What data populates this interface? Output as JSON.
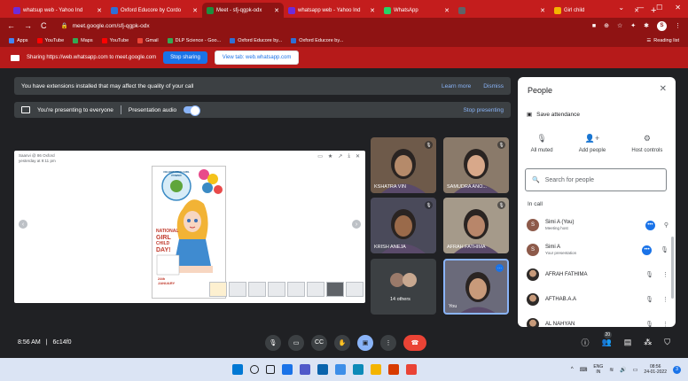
{
  "browser": {
    "tabs": [
      {
        "title": "whatsup web - Yahoo Ind",
        "color": "#6e2bd9",
        "active": false
      },
      {
        "title": "Oxford Educore by Cordo",
        "color": "#2f6fd6",
        "active": false
      },
      {
        "title": "Meet - sfj-qgpk-odx",
        "color": "#1e8e3e",
        "active": true
      },
      {
        "title": "whatsapp web - Yahoo Ind",
        "color": "#6e2bd9",
        "active": false
      },
      {
        "title": "WhatsApp",
        "color": "#25d366",
        "active": false
      },
      {
        "title": "",
        "color": "#5f6368",
        "active": false
      },
      {
        "title": "Girl child",
        "color": "#f4b400",
        "active": false
      }
    ],
    "new_tab": "+",
    "window_controls": [
      "⌄",
      "—",
      "☐",
      "✕"
    ],
    "url": "meet.google.com/sfj-qgpk-odx",
    "bookmarks": [
      {
        "label": "Apps",
        "color": "#4285f4"
      },
      {
        "label": "YouTube",
        "color": "#ff0000"
      },
      {
        "label": "Maps",
        "color": "#34a853"
      },
      {
        "label": "YouTube",
        "color": "#ff0000"
      },
      {
        "label": "Gmail",
        "color": "#ea4335"
      },
      {
        "label": "DLP Science - Goo...",
        "color": "#34a853"
      },
      {
        "label": "Oxford Educore by...",
        "color": "#2f6fd6"
      },
      {
        "label": "Oxford Educore by...",
        "color": "#2f6fd6"
      }
    ],
    "reading_list": "Reading list",
    "profile_initial": "S"
  },
  "sharing": {
    "text": "Sharing https://web.whatsapp.com to meet.google.com",
    "stop_label": "Stop sharing",
    "view_label": "View tab: web.whatsapp.com"
  },
  "meet": {
    "banner_text": "You have extensions installed that may affect the quality of your call",
    "learn_more": "Learn more",
    "dismiss": "Dismiss",
    "presenting_text": "You're presenting to everyone",
    "presentation_audio": "Presentation audio",
    "stop_presenting": "Stop presenting",
    "presentation": {
      "author": "Saanvi @ 86 Oxford",
      "date": "yesterday at 9:11 pm",
      "poster_title": "CELEBRATING GIRL POWER",
      "poster_text": [
        "NATIONAL",
        "GIRL",
        "CHILD",
        "DAY!"
      ],
      "poster_footer": [
        "24th",
        "JANUARY"
      ]
    },
    "tiles": [
      {
        "name": "KSHATRA VIN",
        "skin": "#b58a6a",
        "bg": "#6e5a4a"
      },
      {
        "name": "SAMUDRA ANO...",
        "skin": "#d8a88a",
        "bg": "#8a7a6a"
      },
      {
        "name": "KRISH ANEJA",
        "skin": "#9a6a4a",
        "bg": "#4a4a5a"
      },
      {
        "name": "AFRAH FATHIMA",
        "skin": "#b8866a",
        "bg": "#a59a8a"
      },
      {
        "name": "14 others",
        "skin": "#9a7a6a",
        "bg": "#3c4043"
      },
      {
        "name": "You",
        "skin": "#c89a7a",
        "bg": "#6a6a7a"
      }
    ],
    "meeting_time": "8:56 AM",
    "meeting_code": "6c14f0",
    "participant_count": "20"
  },
  "people_panel": {
    "title": "People",
    "save_attendance": "Save attendance",
    "controls": [
      {
        "label": "All muted",
        "icon": "🎙"
      },
      {
        "label": "Add people",
        "icon": "👤+"
      },
      {
        "label": "Host controls",
        "icon": "⚙"
      }
    ],
    "search_placeholder": "Search for people",
    "in_call": "In call",
    "people": [
      {
        "name": "Simi A (You)",
        "sub": "Meeting host",
        "initial": "S",
        "photo": false,
        "ctrl": "pin"
      },
      {
        "name": "Simi A",
        "sub": "Your presentation",
        "initial": "S",
        "photo": false,
        "ctrl": "muted"
      },
      {
        "name": "AFRAH FATHIMA",
        "sub": "",
        "initial": "",
        "photo": true,
        "ctrl": "muted"
      },
      {
        "name": "AFTHAB.A.A",
        "sub": "",
        "initial": "",
        "photo": true,
        "ctrl": "muted"
      },
      {
        "name": "AL NAHYAN",
        "sub": "",
        "initial": "",
        "photo": true,
        "ctrl": "muted"
      }
    ]
  },
  "taskbar": {
    "icons": [
      {
        "name": "windows-icon",
        "color": "#0078d4"
      },
      {
        "name": "search-icon",
        "color": "#202124"
      },
      {
        "name": "task-view-icon",
        "color": "#202124"
      },
      {
        "name": "widgets-icon",
        "color": "#1a73e8"
      },
      {
        "name": "teams-icon",
        "color": "#5059c9"
      },
      {
        "name": "mail-icon",
        "color": "#0a64ad"
      },
      {
        "name": "store-icon",
        "color": "#3d8ee8"
      },
      {
        "name": "edge-icon",
        "color": "#0c8ab8"
      },
      {
        "name": "explorer-icon",
        "color": "#f4b400"
      },
      {
        "name": "office-icon",
        "color": "#d83b01"
      },
      {
        "name": "chrome-icon",
        "color": "#ea4335"
      }
    ],
    "lang_top": "ENG",
    "lang_bottom": "IN",
    "time": "08:56",
    "date": "24-01-2022",
    "notifications": "3"
  }
}
